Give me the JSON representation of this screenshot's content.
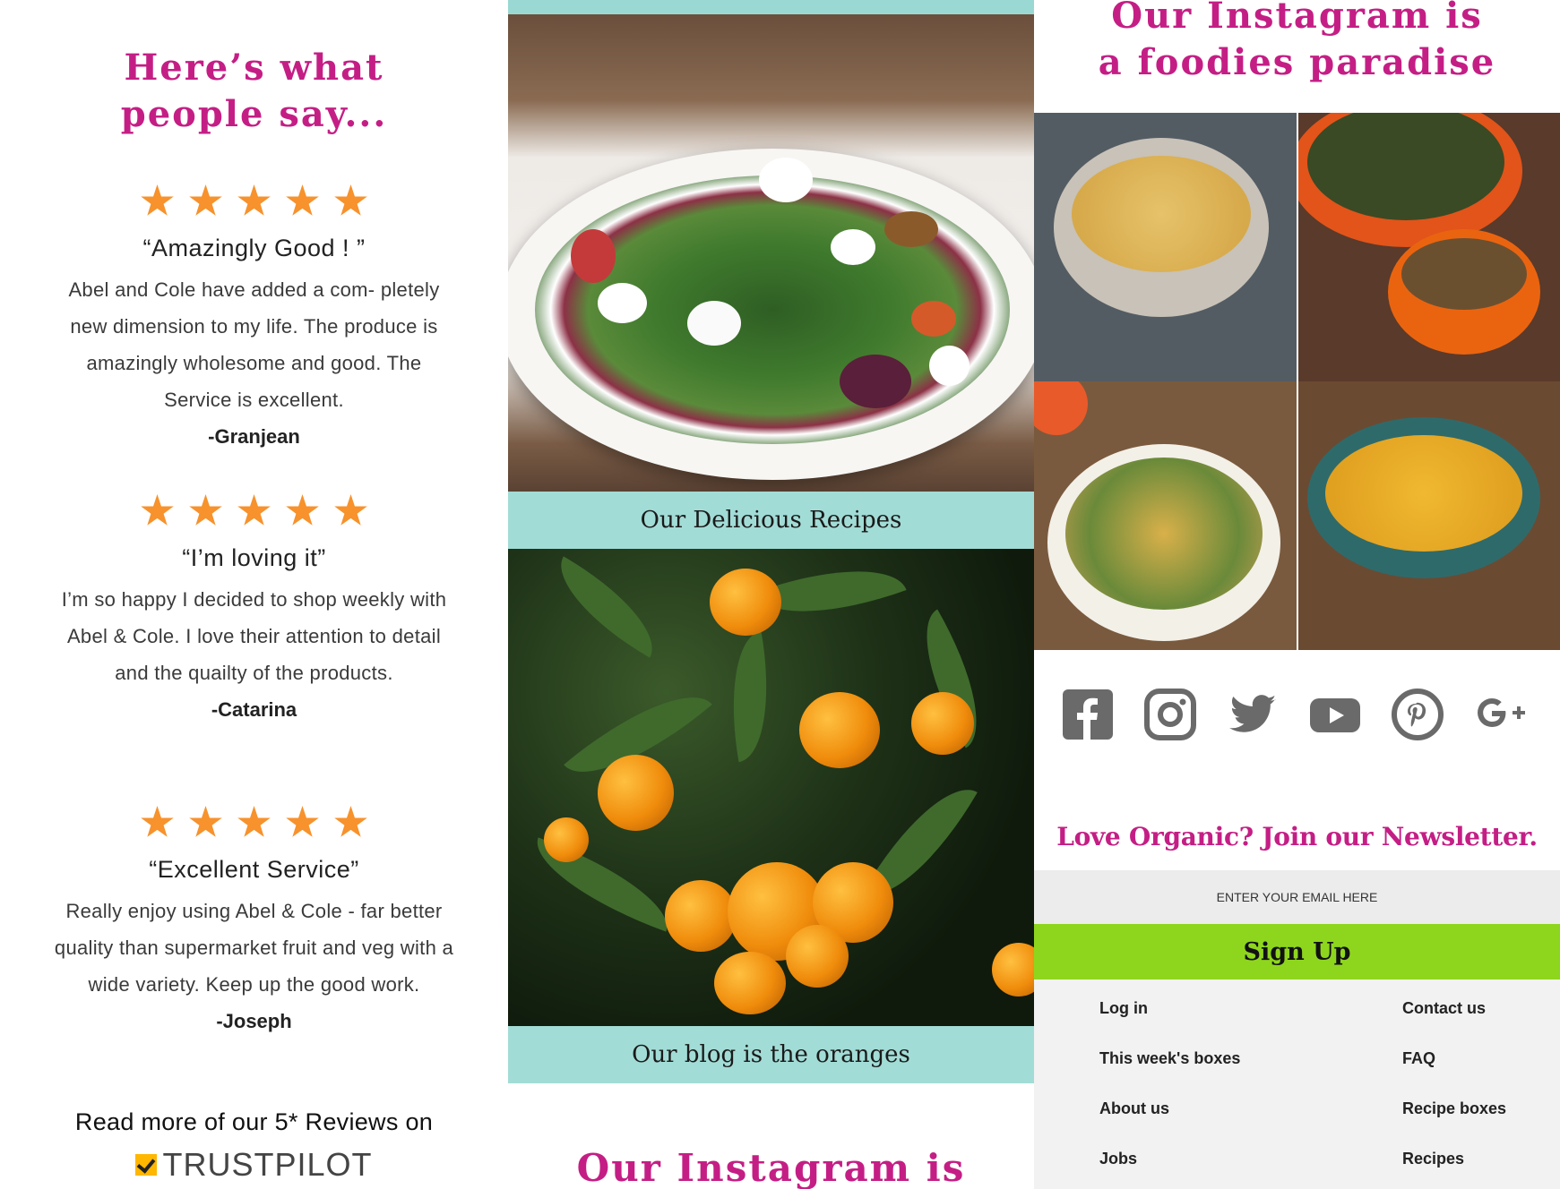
{
  "left": {
    "heading_line1": "Here’s what",
    "heading_line2": "people say...",
    "reviews": [
      {
        "title": "“Amazingly Good ! ”",
        "body": "Abel and Cole have added a com- pletely new  dimension to my life. The produce is amazingly wholesome and good. The Service is excellent.",
        "author": "-Granjean",
        "stars": 5
      },
      {
        "title": "“I’m loving it”",
        "body": "I’m so happy I decided to shop weekly with Abel & Cole. I love their attention to detail and the quailty of the products.",
        "author": "-Catarina",
        "stars": 5
      },
      {
        "title": "“Excellent Service”",
        "body": "Really enjoy using Abel & Cole - far better quality than supermarket fruit and veg with a wide variety. Keep up the good work.",
        "author": "-Joseph",
        "stars": 5
      }
    ],
    "read_more": "Read more of our 5* Reviews on",
    "trustpilot": "TRUSTPILOT"
  },
  "middle": {
    "recipes_caption": "Our Delicious Recipes",
    "blog_caption": "Our blog is the oranges",
    "instagram_heading": "Our Instagram is"
  },
  "right": {
    "instagram_line1": "Our Instagram is",
    "instagram_line2": "a foodies paradise",
    "social_icons": [
      "facebook-icon",
      "instagram-icon",
      "twitter-icon",
      "youtube-icon",
      "pinterest-icon",
      "google-plus-icon"
    ],
    "newsletter_title": "Love Organic? Join our Newsletter.",
    "email_placeholder": "ENTER YOUR EMAIL HERE",
    "signup_label": "Sign Up",
    "footer_links_left": [
      "Log in",
      "This week's boxes",
      "About us",
      "Jobs"
    ],
    "footer_links_right": [
      "Contact us",
      "FAQ",
      "Recipe boxes",
      "Recipes"
    ]
  },
  "colors": {
    "accent_magenta": "#c41e85",
    "star_orange": "#f7922c",
    "teal_band": "#9ad9d3",
    "signup_green": "#8ed61e",
    "icon_grey": "#6a6a6a"
  }
}
